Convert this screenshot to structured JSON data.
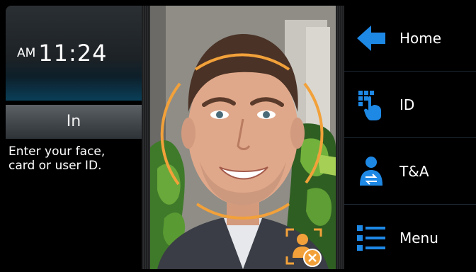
{
  "clock": {
    "ampm": "AM",
    "time": "11:24"
  },
  "status": {
    "mode": "In"
  },
  "prompt": {
    "line1": "Enter your face,",
    "line2": "card or user ID."
  },
  "menu": {
    "items": [
      {
        "label": "Home",
        "icon": "arrow-left-icon"
      },
      {
        "label": "ID",
        "icon": "keypad-touch-icon"
      },
      {
        "label": "T&A",
        "icon": "user-swap-icon"
      },
      {
        "label": "Menu",
        "icon": "list-icon"
      }
    ]
  },
  "colors": {
    "accent_blue": "#1e88e5",
    "face_ring": "#f2a13a",
    "clock_glow": "#0a4f70"
  }
}
